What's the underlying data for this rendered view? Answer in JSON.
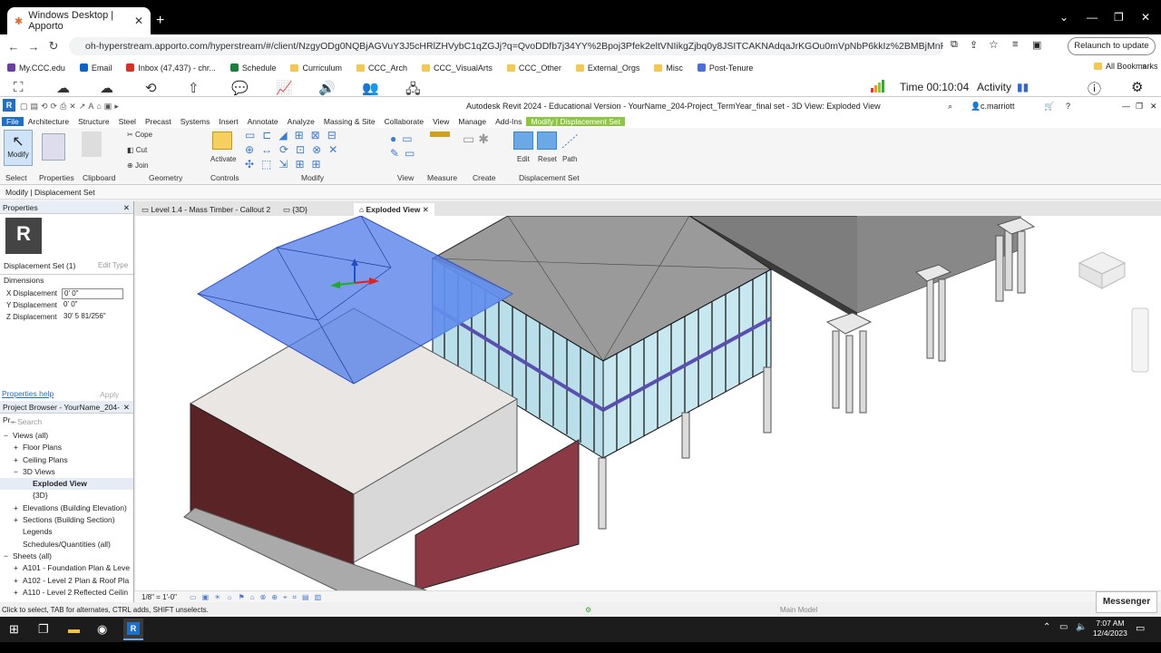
{
  "browser": {
    "tab_title": "Windows Desktop | Apporto",
    "url": "oh-hyperstream.apporto.com/hyperstream/#/client/NzgyODg0NQBjAGVuY3J5cHRlZHVybC1qZGJj?q=QvoDDfb7j34YY%2Bpoj3Pfek2eltVNIikgZjbq0y8JSITCAKNAdqaJrKGOu0mVpNbP6kkIz%2BMBjMnRjUaQGlptdkjrGS8fJAfoLcz%...",
    "relaunch_label": "Relaunch to update",
    "bookmarks": [
      {
        "label": "My.CCC.edu",
        "icon": "ccc-icon"
      },
      {
        "label": "Email",
        "icon": "outlook-icon"
      },
      {
        "label": "Inbox (47,437) - chr...",
        "icon": "gmail-icon"
      },
      {
        "label": "Schedule",
        "icon": "sheets-icon"
      },
      {
        "label": "Curriculum",
        "icon": "folder-icon"
      },
      {
        "label": "CCC_Arch",
        "icon": "folder-icon"
      },
      {
        "label": "CCC_VisualArts",
        "icon": "folder-icon"
      },
      {
        "label": "CCC_Other",
        "icon": "folder-icon"
      },
      {
        "label": "External_Orgs",
        "icon": "folder-icon"
      },
      {
        "label": "Misc",
        "icon": "folder-icon"
      },
      {
        "label": "Post-Tenure",
        "icon": "doc-icon"
      }
    ],
    "all_bookmarks": "All Bookmarks"
  },
  "apporto": {
    "time": "Time 00:10:04",
    "activity": "Activity"
  },
  "revit": {
    "title": "Autodesk Revit 2024 - Educational Version - YourName_204-Project_TermYear_final set - 3D View: Exploded View",
    "user": "c.marriott",
    "menu": [
      "File",
      "Architecture",
      "Structure",
      "Steel",
      "Precast",
      "Systems",
      "Insert",
      "Annotate",
      "Analyze",
      "Massing & Site",
      "Collaborate",
      "View",
      "Manage",
      "Add-Ins",
      "Modify | Displacement Set"
    ],
    "ribbon": {
      "modify": "Modify",
      "cope": "Cope",
      "cut": "Cut",
      "join": "Join",
      "activate": "Activate",
      "edit": "Edit",
      "reset": "Reset",
      "path": "Path",
      "groups": [
        "Select",
        "Properties",
        "Clipboard",
        "Geometry",
        "Controls",
        "Modify",
        "View",
        "Measure",
        "Create",
        "Displacement Set"
      ]
    },
    "context": "Modify | Displacement Set",
    "properties": {
      "header": "Properties",
      "type": "Displacement Set (1)",
      "edit_type": "Edit Type",
      "section": "Dimensions",
      "rows": [
        {
          "label": "X Displacement",
          "value": "0'  0\""
        },
        {
          "label": "Y Displacement",
          "value": "0'  0\""
        },
        {
          "label": "Z Displacement",
          "value": "30'  5 81/256\""
        }
      ],
      "help": "Properties help",
      "apply": "Apply"
    },
    "browser": {
      "header": "Project Browser - YourName_204-Pr...",
      "search": "Search",
      "items": [
        {
          "t": "Views (all)",
          "i": 0,
          "s": "−"
        },
        {
          "t": "Floor Plans",
          "i": 1,
          "s": "+"
        },
        {
          "t": "Ceiling Plans",
          "i": 1,
          "s": "+"
        },
        {
          "t": "3D Views",
          "i": 1,
          "s": "−"
        },
        {
          "t": "Exploded View",
          "i": 2,
          "s": ""
        },
        {
          "t": "{3D}",
          "i": 2,
          "s": ""
        },
        {
          "t": "Elevations (Building Elevation)",
          "i": 1,
          "s": "+"
        },
        {
          "t": "Sections (Building Section)",
          "i": 1,
          "s": "+"
        },
        {
          "t": "Legends",
          "i": 1,
          "s": ""
        },
        {
          "t": "Schedules/Quantities (all)",
          "i": 1,
          "s": ""
        },
        {
          "t": "Sheets (all)",
          "i": 0,
          "s": "−"
        },
        {
          "t": "A101 - Foundation Plan & Leve",
          "i": 1,
          "s": "+"
        },
        {
          "t": "A102 - Level 2 Plan & Roof Pla",
          "i": 1,
          "s": "+"
        },
        {
          "t": "A110 - Level 2 Reflected Ceilin",
          "i": 1,
          "s": "+"
        }
      ]
    },
    "view_tabs": [
      "Level 1.4 - Mass Timber - Callout 2",
      "{3D}",
      "Exploded View"
    ],
    "scale": "1/8\" = 1'-0\"",
    "status": "Click to select, TAB for alternates, CTRL adds, SHIFT unselects.",
    "model": "Main Model"
  },
  "messenger": "Messenger",
  "taskbar": {
    "time": "7:07 AM",
    "date": "12/4/2023"
  }
}
